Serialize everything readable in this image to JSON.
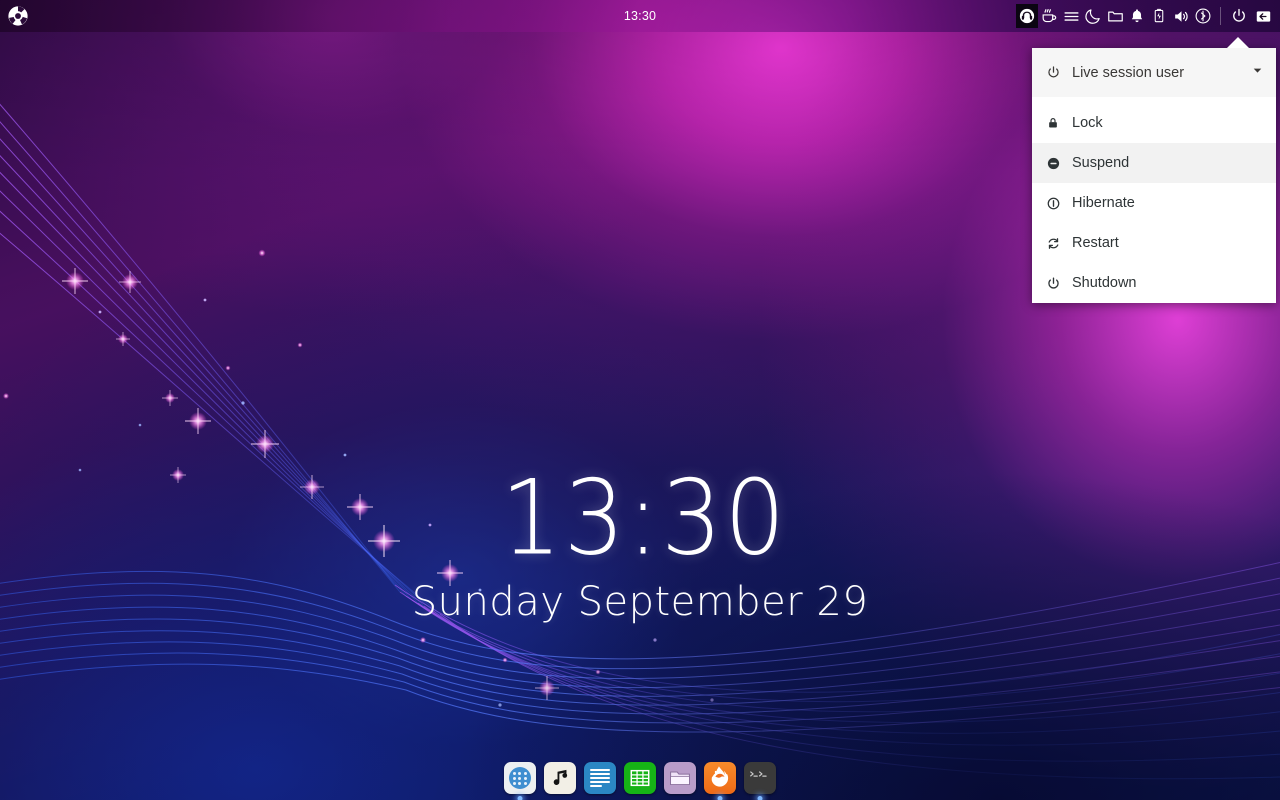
{
  "panel": {
    "logo_icon": "distro-logo-icon",
    "clock": "13:30",
    "tray": [
      {
        "name": "headphones-icon",
        "active": true
      },
      {
        "name": "caffeine-icon",
        "active": false
      },
      {
        "name": "menu-icon",
        "active": false
      },
      {
        "name": "night-mode-icon",
        "active": false
      },
      {
        "name": "folder-icon",
        "active": false
      },
      {
        "name": "notifications-bell-icon",
        "active": false
      },
      {
        "name": "battery-icon",
        "active": false
      },
      {
        "name": "volume-icon",
        "active": false
      },
      {
        "name": "bluetooth-icon",
        "active": false
      }
    ],
    "power_button": "power-icon",
    "logout_button": "logout-icon"
  },
  "session_menu": {
    "header": {
      "icon": "power-icon",
      "label": "Live session user",
      "caret": "chevron-down-icon"
    },
    "items": [
      {
        "icon": "lock-icon",
        "label": "Lock",
        "hover": false
      },
      {
        "icon": "suspend-icon",
        "label": "Suspend",
        "hover": true
      },
      {
        "icon": "hibernate-icon",
        "label": "Hibernate",
        "hover": false
      },
      {
        "icon": "restart-icon",
        "label": "Restart",
        "hover": false
      },
      {
        "icon": "shutdown-icon",
        "label": "Shutdown",
        "hover": false
      }
    ]
  },
  "desktop": {
    "time": "13:30",
    "date": "Sunday September 29"
  },
  "dock": {
    "items": [
      {
        "name": "app-launcher",
        "label": "Application Launcher",
        "running": true
      },
      {
        "name": "music-player",
        "label": "Music Player",
        "running": false
      },
      {
        "name": "writer",
        "label": "Document Writer",
        "running": false
      },
      {
        "name": "spreadsheet",
        "label": "Spreadsheet",
        "running": false
      },
      {
        "name": "file-manager",
        "label": "File Manager",
        "running": false
      },
      {
        "name": "firefox",
        "label": "Firefox",
        "running": true
      },
      {
        "name": "terminal",
        "label": "Terminal",
        "running": true
      }
    ]
  },
  "colors": {
    "panel_text": "#ffffff",
    "menu_bg": "#ffffff",
    "menu_header_bg": "#f6f6f6",
    "menu_hover_bg": "#f2f2f2",
    "menu_text": "#2e3436",
    "accent_magenta": "#ff3ce6",
    "accent_blue": "#1228a0"
  }
}
